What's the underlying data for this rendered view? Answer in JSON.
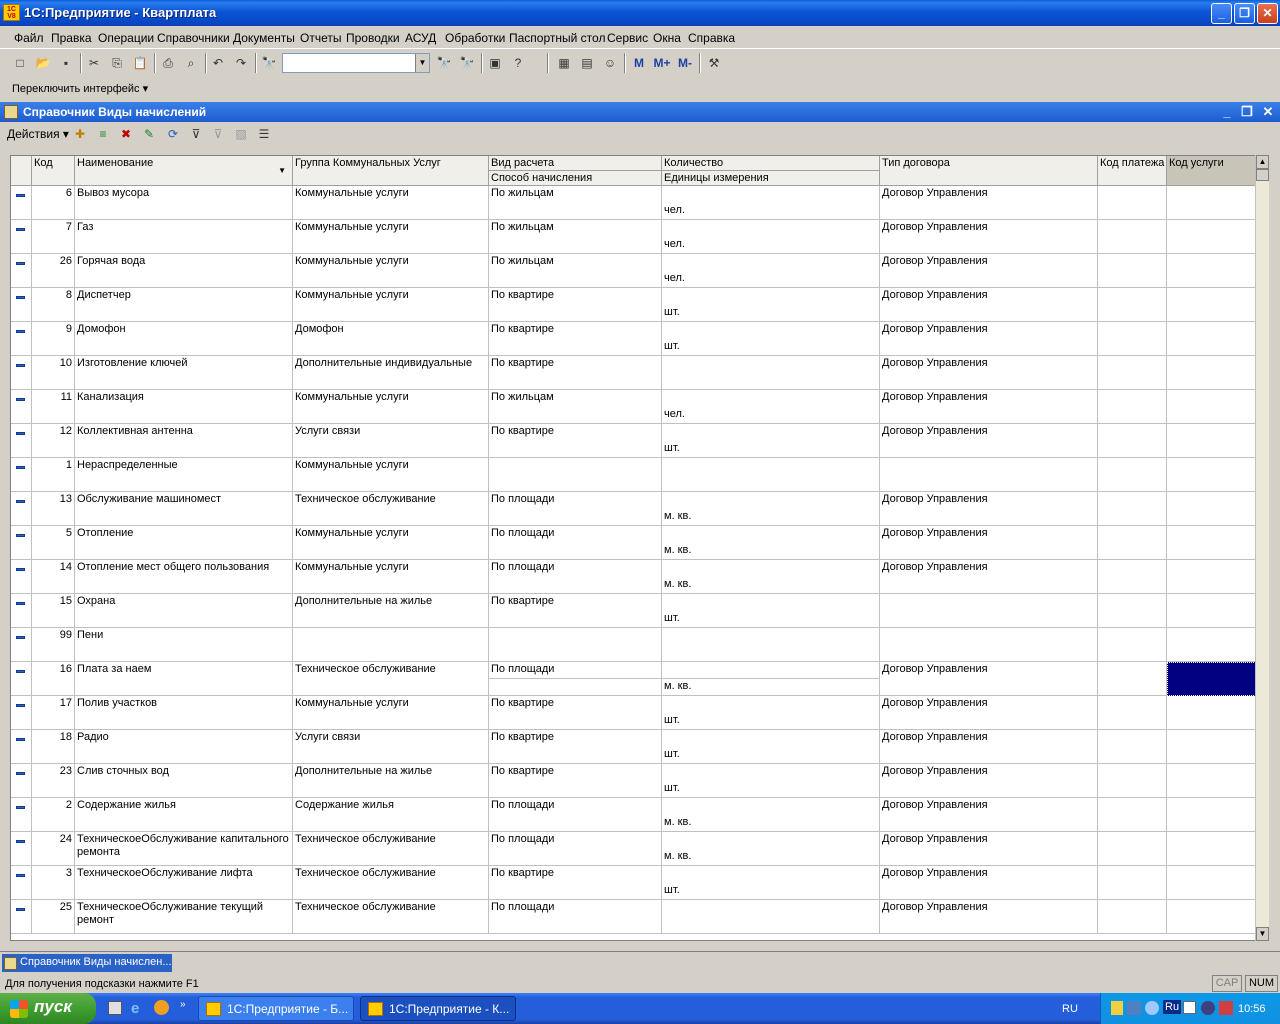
{
  "window": {
    "title": "1С:Предприятие - Квартплата",
    "icon_text": "1C V8"
  },
  "menu": [
    "Файл",
    "Правка",
    "Операции",
    "Справочники",
    "Документы",
    "Отчеты",
    "Проводки",
    "АСУД",
    "Обработки",
    "Паспортный стол",
    "Сервис",
    "Окна",
    "Справка"
  ],
  "toolbar2": {
    "switch_interface": "Переключить интерфейс"
  },
  "toolbar1": {
    "m_label": "M",
    "mplus_label": "M+",
    "mminus_label": "M-",
    "search_value": ""
  },
  "doc": {
    "title": "Справочник Виды начислений",
    "actions_label": "Действия"
  },
  "grid": {
    "headers": {
      "code": "Код",
      "name": "Наименование",
      "group": "Группа Коммунальных  Услуг",
      "calc_type": "Вид расчета",
      "calc_method": "Способ начисления",
      "quantity": "Количество",
      "units": "Единицы измерения",
      "contract": "Тип договора",
      "pay_code": "Код платежа",
      "service_code": "Код услуги"
    },
    "rows": [
      {
        "code": "6",
        "name": "Вывоз мусора",
        "group": "Коммунальные услуги",
        "calc": "По жильцам",
        "units": "чел.",
        "contract": "Договор Управления"
      },
      {
        "code": "7",
        "name": "Газ",
        "group": "Коммунальные услуги",
        "calc": "По жильцам",
        "units": "чел.",
        "contract": "Договор Управления"
      },
      {
        "code": "26",
        "name": "Горячая вода",
        "group": "Коммунальные услуги",
        "calc": "По жильцам",
        "units": "чел.",
        "contract": "Договор Управления"
      },
      {
        "code": "8",
        "name": "Диспетчер",
        "group": "Коммунальные услуги",
        "calc": "По квартире",
        "units": "шт.",
        "contract": "Договор Управления"
      },
      {
        "code": "9",
        "name": "Домофон",
        "group": "Домофон",
        "calc": "По квартире",
        "units": "шт.",
        "contract": "Договор Управления"
      },
      {
        "code": "10",
        "name": "Изготовление ключей",
        "group": "Дополнительные индивидуальные",
        "calc": "По квартире",
        "units": "",
        "contract": "Договор Управления"
      },
      {
        "code": "11",
        "name": "Канализация",
        "group": "Коммунальные услуги",
        "calc": "По жильцам",
        "units": "чел.",
        "contract": "Договор Управления"
      },
      {
        "code": "12",
        "name": "Коллективная антенна",
        "group": "Услуги связи",
        "calc": "По квартире",
        "units": "шт.",
        "contract": "Договор Управления"
      },
      {
        "code": "1",
        "name": "Нераспределенные",
        "group": "Коммунальные услуги",
        "calc": "",
        "units": "",
        "contract": ""
      },
      {
        "code": "13",
        "name": "Обслуживание машиномест",
        "group": "Техническое обслуживание",
        "calc": "По площади",
        "units": "м. кв.",
        "contract": "Договор Управления"
      },
      {
        "code": "5",
        "name": "Отопление",
        "group": "Коммунальные услуги",
        "calc": "По площади",
        "units": "м. кв.",
        "contract": "Договор Управления"
      },
      {
        "code": "14",
        "name": "Отопление мест общего пользования",
        "group": "Коммунальные услуги",
        "calc": "По площади",
        "units": "м. кв.",
        "contract": "Договор Управления"
      },
      {
        "code": "15",
        "name": "Охрана",
        "group": "Дополнительные на жилье",
        "calc": "По квартире",
        "units": "шт.",
        "contract": ""
      },
      {
        "code": "99",
        "name": "Пени",
        "group": "",
        "calc": "",
        "units": "",
        "contract": ""
      },
      {
        "code": "16",
        "name": "Плата за наем",
        "group": "Техническое обслуживание",
        "calc": "По площади",
        "units": "м. кв.",
        "contract": "Договор Управления"
      },
      {
        "code": "17",
        "name": "Полив участков",
        "group": "Коммунальные услуги",
        "calc": "По квартире",
        "units": "шт.",
        "contract": "Договор Управления"
      },
      {
        "code": "18",
        "name": "Радио",
        "group": "Услуги связи",
        "calc": "По квартире",
        "units": "шт.",
        "contract": "Договор Управления"
      },
      {
        "code": "23",
        "name": "Слив сточных вод",
        "group": "Дополнительные на жилье",
        "calc": "По квартире",
        "units": "шт.",
        "contract": "Договор Управления"
      },
      {
        "code": "2",
        "name": "Содержание жилья",
        "group": "Содержание жилья",
        "calc": "По площади",
        "units": "м. кв.",
        "contract": "Договор Управления"
      },
      {
        "code": "24",
        "name": "ТехническоеОбслуживание капитального ремонта",
        "group": "Техническое обслуживание",
        "calc": "По площади",
        "units": "м. кв.",
        "contract": "Договор Управления"
      },
      {
        "code": "3",
        "name": "ТехническоеОбслуживание лифта",
        "group": "Техническое обслуживание",
        "calc": "По квартире",
        "units": "шт.",
        "contract": "Договор Управления"
      },
      {
        "code": "25",
        "name": "ТехническоеОбслуживание текущий ремонт",
        "group": "Техническое обслуживание",
        "calc": "По площади",
        "units": "",
        "contract": "Договор Управления"
      }
    ],
    "selected_row": 14,
    "selected_color": "#000080"
  },
  "wintab": {
    "label": "Справочник Виды начислен..."
  },
  "status": {
    "hint": "Для получения подсказки нажмите F1",
    "cap": "CAP",
    "num": "NUM"
  },
  "taskbar": {
    "start": "пуск",
    "tasks": [
      "1С:Предприятие - Б...",
      "1С:Предприятие - К..."
    ],
    "lang": "RU",
    "tray_lang": "Ru",
    "clock": "10:56"
  }
}
